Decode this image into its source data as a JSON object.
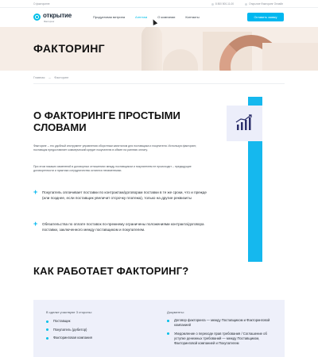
{
  "topbar": {
    "left_text": "О факторинге",
    "phone": "8 800 500-11-00",
    "online": "Открытие Факторинг Онлайн"
  },
  "header": {
    "logo_name": "открытие",
    "logo_sub": "Факторинг",
    "nav": [
      "Продуктовая витрина",
      "Агентам",
      "О компании",
      "Контакты"
    ],
    "cta": "Оставить заявку"
  },
  "hero": {
    "title": "ФАКТОРИНГ"
  },
  "breadcrumb": {
    "home": "Главная",
    "sep": "→",
    "current": "Факторинг"
  },
  "about": {
    "title": "О ФАКТОРИНГЕ ПРОСТЫМИ СЛОВАМИ",
    "p1": "Факторинг – это удобный инструмент управления оборотным капиталом для поставщика и покупателя. Используя факторинг, поставщик предоставляет коммерческий кредит покупателю в обмен на раннюю оплату.",
    "p2": "При этом никаких изменений в договорных отношениях между поставщиком и покупателем не происходит – предыдущие договоренности и практика сотрудничества остаются неизменными.",
    "feature1": "Покупатель оплачивает поставки по контрактам/договорам поставки в те же сроки, что и прежде (или позднее, если поставщик увеличит отсрочку платежа), только на другие реквизиты",
    "feature2": "Обязательства по оплате поставок по-прежнему ограничены положениями контракта/договора поставки, заключенного между поставщиком и покупателем."
  },
  "how": {
    "title": "КАК РАБОТАЕТ ФАКТОРИНГ?",
    "left_title": "В сделке участвуют 3 стороны:",
    "parties": [
      "Поставщик",
      "Покупатель (дебитор)",
      "Факторинговая компания"
    ],
    "right_title": "Документы:",
    "documents": [
      "Договор факторинга — между Поставщиком и Факторинговой компанией",
      "Уведомление о переходе прав требования / Соглашение об уступке денежных требований — между Поставщиком, Факторинговой компанией и Покупателем"
    ]
  },
  "colors": {
    "accent": "#00b7ef",
    "panel": "#eef0fa",
    "hero_bg": "#f6ede6"
  },
  "icons": [
    "logo-icon",
    "chart-growth-icon",
    "plus-icon",
    "bullet-icon",
    "cursor-icon"
  ]
}
